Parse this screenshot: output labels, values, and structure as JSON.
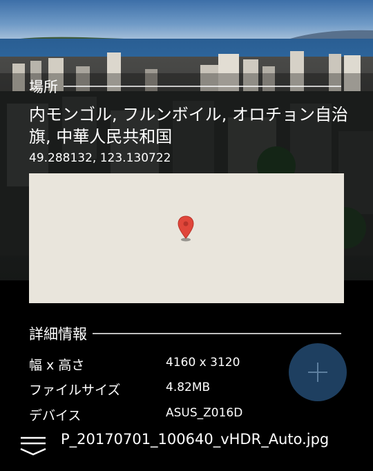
{
  "location": {
    "header": "場所",
    "place_name": "内モンゴル, フルンボイル, オロチョン自治旗, 中華人民共和国",
    "coordinates": "49.288132, 123.130722"
  },
  "details": {
    "header": "詳細情報",
    "rows": [
      {
        "label": "幅 x 高さ",
        "value": "4160 x 3120"
      },
      {
        "label": "ファイルサイズ",
        "value": "4.82MB"
      },
      {
        "label": "デバイス",
        "value": "ASUS_Z016D"
      }
    ]
  },
  "footer": {
    "filename": "P_20170701_100640_vHDR_Auto.jpg"
  },
  "icons": {
    "map_pin": "map-pin-icon",
    "fab": "plus-icon",
    "menu": "menu-icon"
  },
  "colors": {
    "map_background": "#e9e5dc",
    "pin": "#e0463a",
    "fab": "#1e3f60"
  }
}
